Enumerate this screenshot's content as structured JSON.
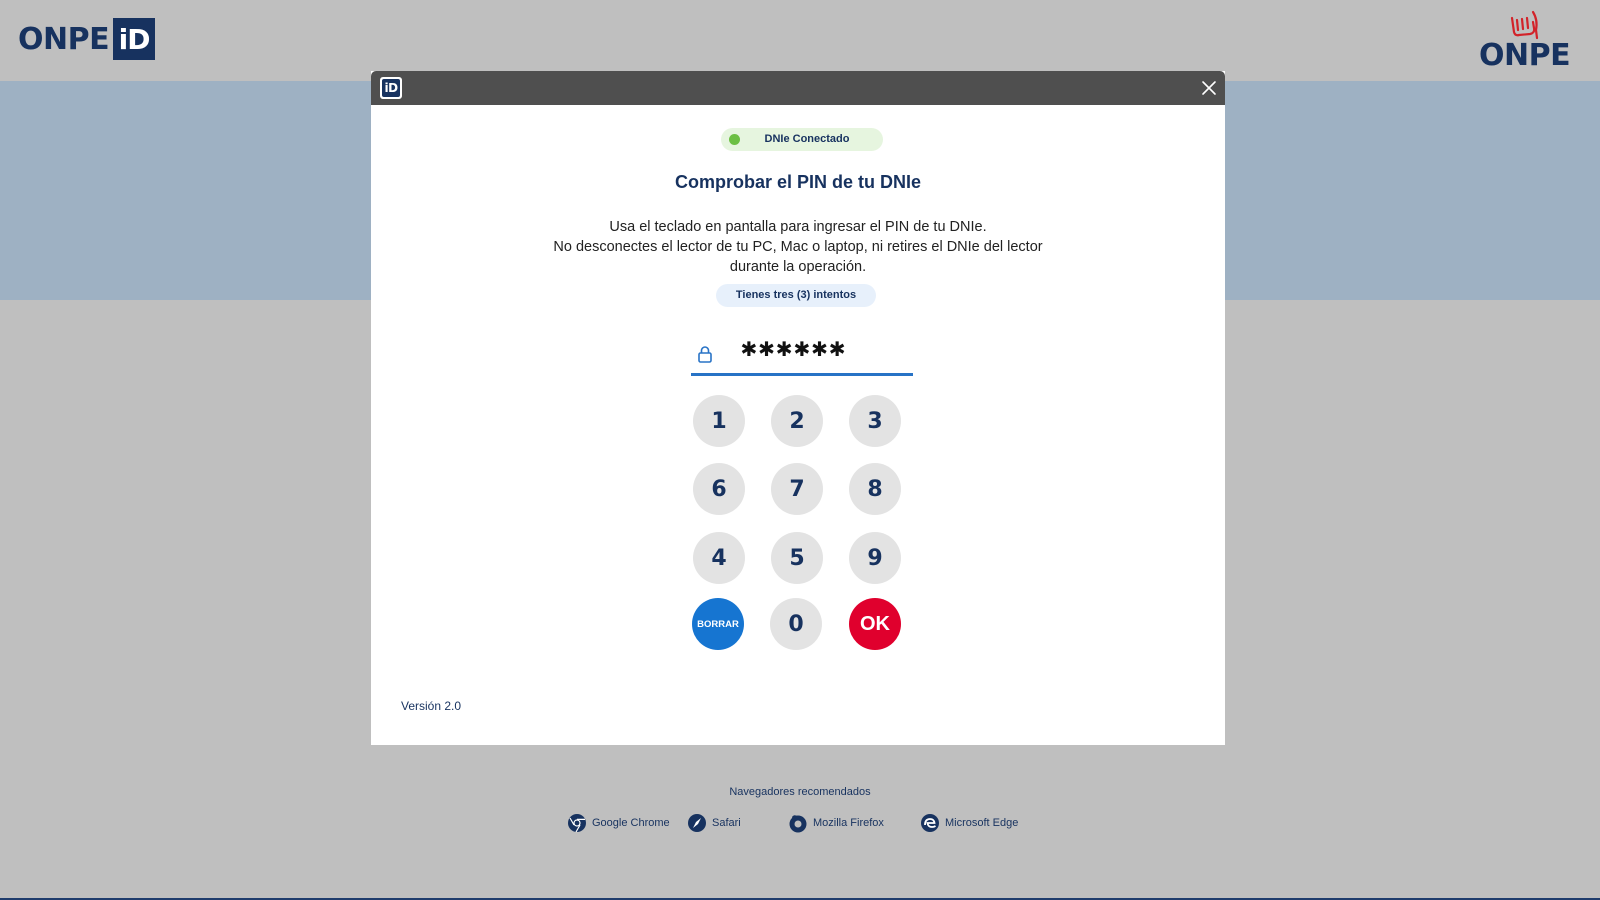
{
  "header": {
    "left_logo": {
      "word": "ONPE",
      "badge": "iD"
    },
    "right_logo": {
      "word": "ONPE"
    }
  },
  "modal": {
    "bar_icon": "iD",
    "close_icon": "close-icon",
    "status_badge": "DNIe Conectado",
    "status_color": "#6cbf44",
    "title": "Comprobar el PIN de tu DNIe",
    "description": [
      "Usa el teclado en pantalla para ingresar el PIN de tu DNIe.",
      "No desconectes el lector de tu PC, Mac o laptop, ni retires el DNIe del lector",
      "durante la operación."
    ],
    "attempts": "Tienes tres (3) intentos",
    "pin_value": "✱✱✱✱✱✱",
    "keypad": {
      "rows": [
        [
          "1",
          "2",
          "3"
        ],
        [
          "6",
          "7",
          "8"
        ],
        [
          "4",
          "5",
          "9"
        ]
      ],
      "delete_label": "BORRAR",
      "zero_label": "0",
      "ok_label": "OK"
    },
    "version": "Versión 2.0"
  },
  "footer": {
    "browsers_title": "Navegadores recomendados",
    "browsers": [
      {
        "name": "Google Chrome",
        "icon": "chrome-icon"
      },
      {
        "name": "Safari",
        "icon": "safari-icon"
      },
      {
        "name": "Mozilla Firefox",
        "icon": "firefox-icon"
      },
      {
        "name": "Microsoft Edge",
        "icon": "edge-icon"
      }
    ]
  },
  "colors": {
    "brand_navy": "#17325f",
    "band_blue": "#9eb1c3",
    "delete_blue": "#1675d1",
    "ok_red": "#e0002d",
    "pin_underline": "#2873c6"
  }
}
